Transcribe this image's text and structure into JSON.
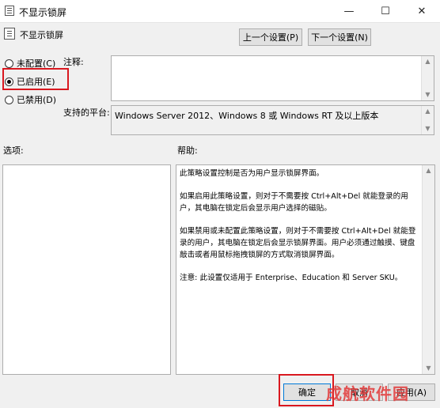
{
  "window": {
    "title": "不显示锁屏",
    "buttons": {
      "minimize": "—",
      "maximize": "☐",
      "close": "✕"
    }
  },
  "header": {
    "policy_name": "不显示锁屏",
    "prev_button": "上一个设置(P)",
    "next_button": "下一个设置(N)"
  },
  "state": {
    "options": [
      {
        "label": "未配置(C)",
        "checked": false
      },
      {
        "label": "已启用(E)",
        "checked": true
      },
      {
        "label": "已禁用(D)",
        "checked": false
      }
    ]
  },
  "comment": {
    "label": "注释:",
    "value": ""
  },
  "platform": {
    "label": "支持的平台:",
    "value": "Windows Server 2012、Windows 8 或 Windows RT 及以上版本"
  },
  "options_section": {
    "label": "选项:"
  },
  "help_section": {
    "label": "帮助:",
    "paragraphs": [
      "此策略设置控制是否为用户显示锁屏界面。",
      "如果启用此策略设置，则对于不需要按 Ctrl+Alt+Del 就能登录的用户，其电脑在锁定后会显示用户选择的磁贴。",
      "如果禁用或未配置此策略设置，则对于不需要按 Ctrl+Alt+Del 就能登录的用户，其电脑在锁定后会显示锁屏界面。用户必须通过触摸、键盘敲击或者用鼠标拖拽锁屏的方式取消锁屏界面。",
      "注意: 此设置仅适用于 Enterprise、Education 和 Server SKU。"
    ]
  },
  "footer": {
    "ok": "确定",
    "cancel": "取消",
    "apply": "应用(A)"
  },
  "watermark": "成航软件园",
  "colors": {
    "highlight": "#d9181f",
    "watermark": "#e33a3a"
  }
}
